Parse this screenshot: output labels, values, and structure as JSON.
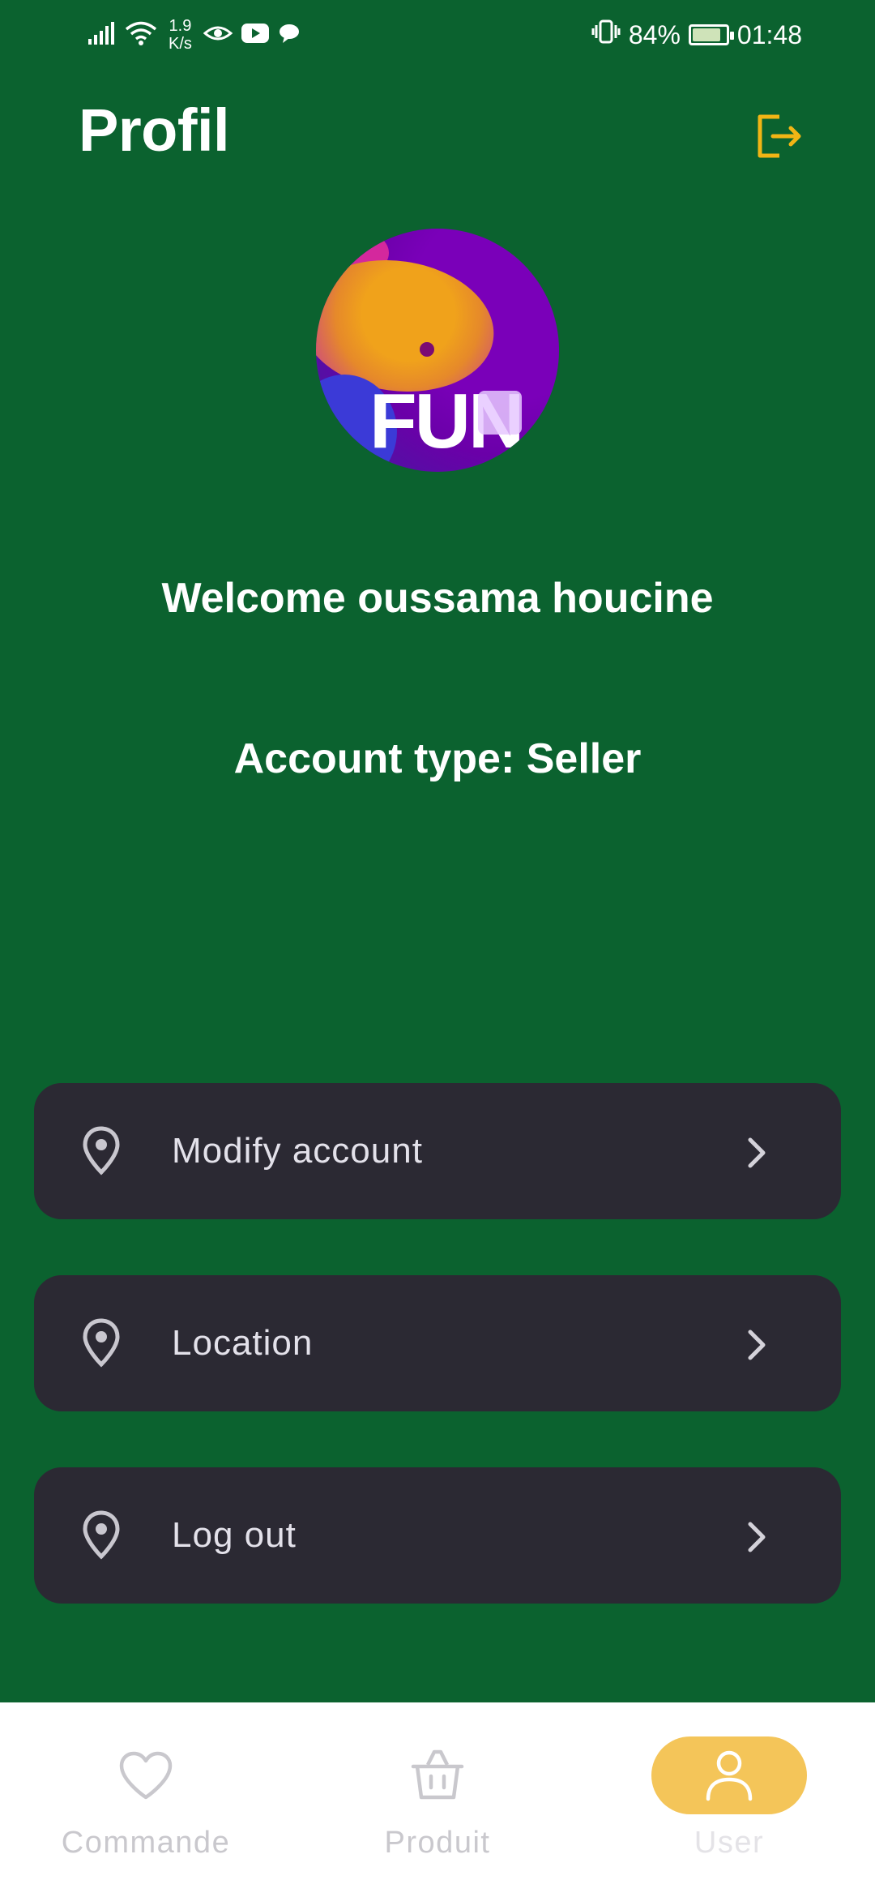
{
  "status_bar": {
    "net_speed_value": "1.9",
    "net_speed_unit": "K/s",
    "battery_percent": "84%",
    "time": "01:48",
    "battery_level": 0.84
  },
  "header": {
    "title": "Profil"
  },
  "profile": {
    "avatar_logo_text": "FUN",
    "welcome": "Welcome oussama houcine",
    "account_type": "Account type: Seller"
  },
  "menu": {
    "items": [
      {
        "label": "Modify account",
        "icon": "location-pin-icon"
      },
      {
        "label": "Location",
        "icon": "location-pin-icon"
      },
      {
        "label": "Log out",
        "icon": "location-pin-icon"
      }
    ]
  },
  "bottom_nav": {
    "items": [
      {
        "label": "Commande",
        "icon": "heart-icon",
        "active": false
      },
      {
        "label": "Produit",
        "icon": "basket-icon",
        "active": false
      },
      {
        "label": "User",
        "icon": "user-icon",
        "active": true
      }
    ]
  },
  "colors": {
    "background": "#0b622f",
    "accent": "#f4c559",
    "logout_icon": "#f1b515",
    "menu_card": "#2b2933",
    "nav_background": "#ffffff"
  }
}
